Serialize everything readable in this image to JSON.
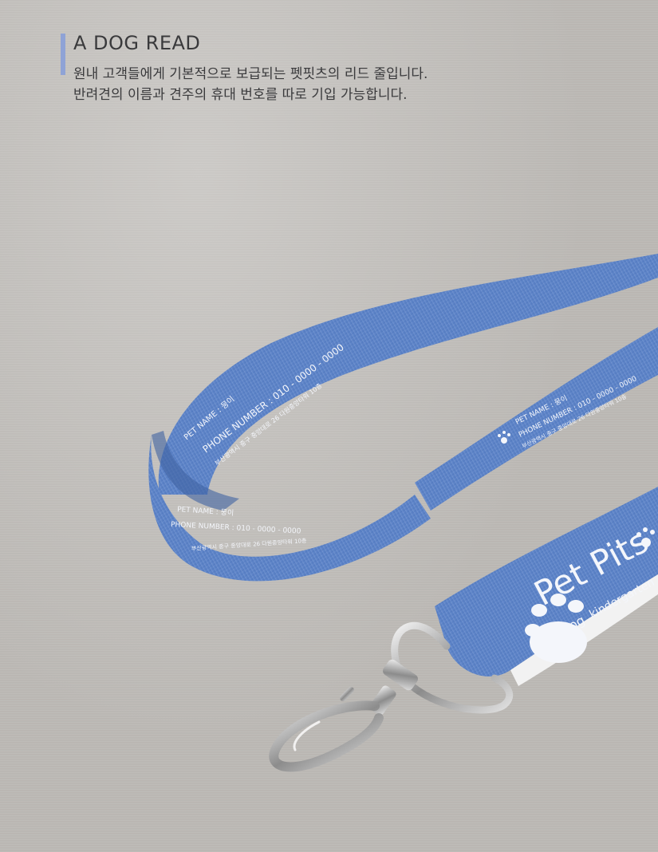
{
  "header": {
    "title": "A DOG READ",
    "description_lines": [
      "원내 고객들에게 기본적으로 보급되는 펫핏츠의 리드 줄입니다.",
      "반려견의 이름과 견주의 휴대 번호를 따로 기입 가능합니다."
    ]
  },
  "leash": {
    "pet_name_line": "PET NAME : 뭉이",
    "phone_line": "PHONE NUMBER : 010 - 0000 - 0000",
    "phone_line_upper": "PHONE NUMBER : 010 - 0000 - 0000",
    "address_line": "부산광역시 중구 중앙대로 26 다원중앙타워 10층",
    "brand_name": "Pet Pits",
    "brand_sub_dog": "dog",
    "brand_sub_kinder": "kindergarten"
  },
  "colors": {
    "strap": "#5b82c6",
    "strap_dark": "#4a6fb0",
    "text_dark": "#3a3a3c",
    "accent": "#8fa3d6",
    "background": "#bcb9b5"
  }
}
